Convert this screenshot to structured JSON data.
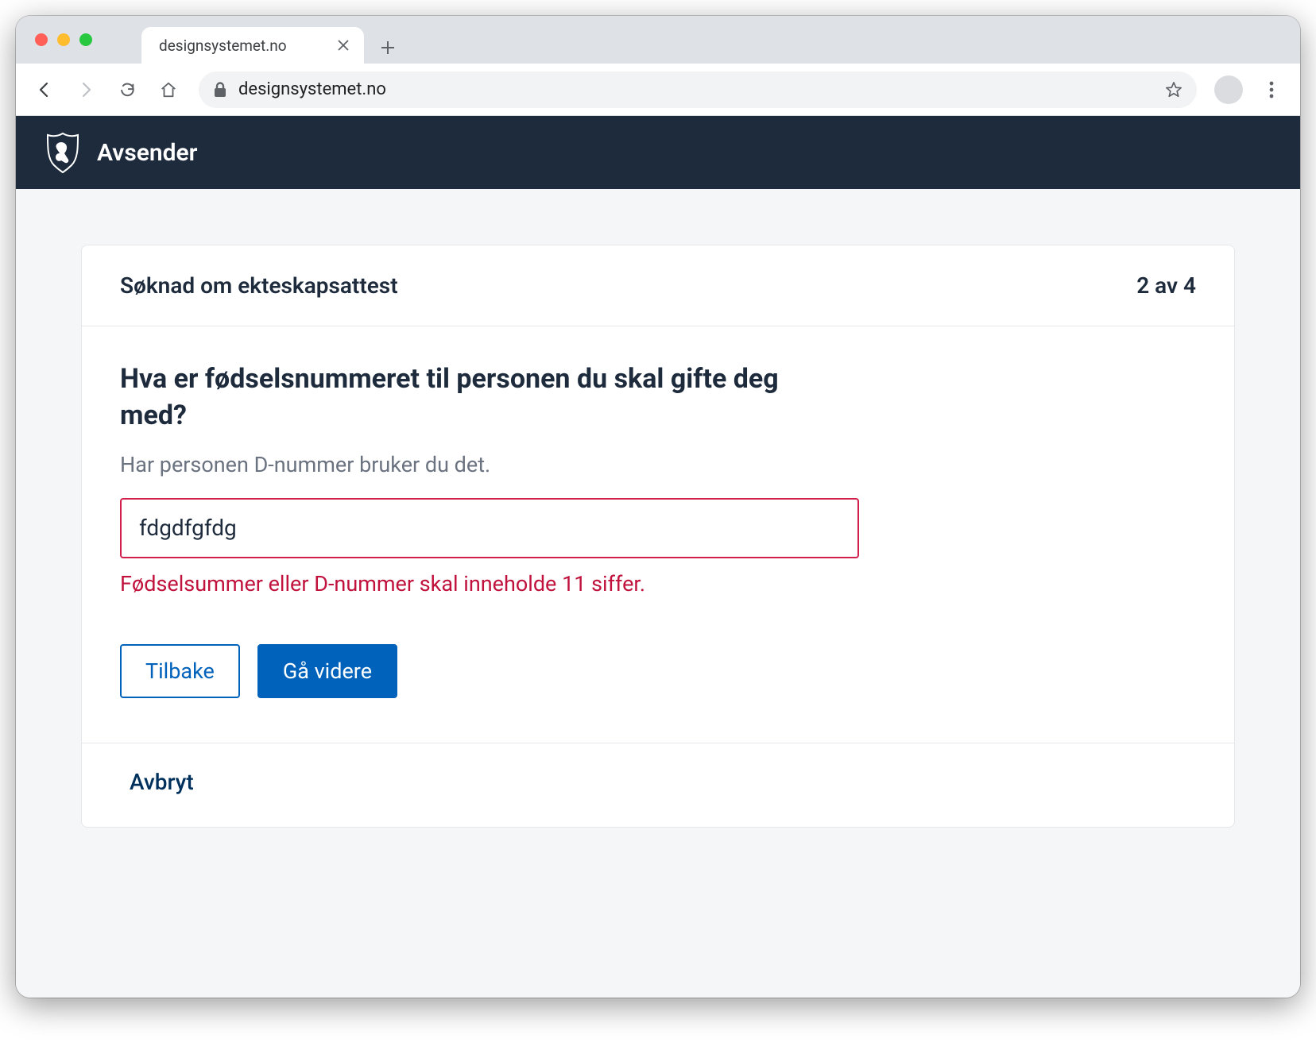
{
  "browser": {
    "tab_title": "designsystemet.no",
    "url": "designsystemet.no"
  },
  "app_header": {
    "brand": "Avsender"
  },
  "card": {
    "title": "Søknad om ekteskapsattest",
    "step": "2 av 4"
  },
  "form": {
    "question": "Hva er fødselsnummeret til personen du skal gifte deg med?",
    "hint": "Har personen D-nummer bruker du det.",
    "value": "fdgdfgfdg",
    "error": "Fødselsummer eller D-nummer skal inneholde 11 siffer."
  },
  "buttons": {
    "back": "Tilbake",
    "next": "Gå videre",
    "cancel": "Avbryt"
  },
  "colors": {
    "header_bg": "#1e2b3c",
    "primary": "#0062ba",
    "error": "#c0123c",
    "error_border": "#d0204b"
  }
}
